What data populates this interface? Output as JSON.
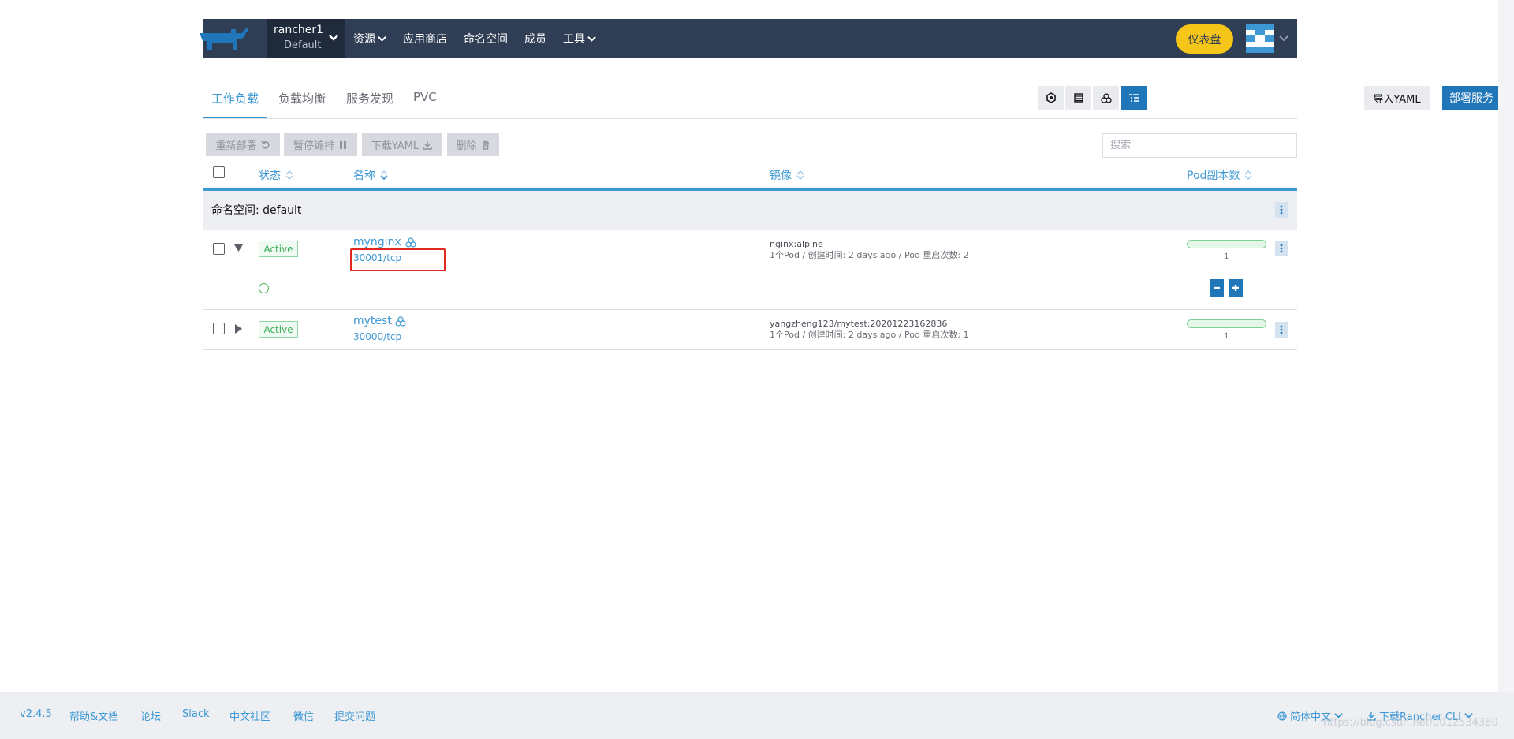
{
  "header": {
    "cluster_name": "rancher1",
    "project_name": "Default",
    "nav": [
      {
        "label": "资源",
        "dropdown": true
      },
      {
        "label": "应用商店",
        "dropdown": false
      },
      {
        "label": "命名空间",
        "dropdown": false
      },
      {
        "label": "成员",
        "dropdown": false
      },
      {
        "label": "工具",
        "dropdown": true
      }
    ],
    "dashboard_label": "仪表盘",
    "colors": {
      "bar": "#2f3e55",
      "cluster_bg": "#1f2a3a",
      "dashboard": "#f5c518",
      "logo": "#1f76b9"
    }
  },
  "tabs": {
    "items": [
      "工作负载",
      "负载均衡",
      "服务发现",
      "PVC"
    ],
    "active_index": 0,
    "view_icons": [
      "node-view-icon",
      "list-view-icon",
      "workload-view-icon",
      "group-view-icon"
    ],
    "selected_view": 3,
    "import_label": "导入YAML",
    "deploy_label": "部署服务"
  },
  "bulk_actions": {
    "redeploy": "重新部署",
    "pause": "暂停编排",
    "download": "下载YAML",
    "delete": "删除"
  },
  "search": {
    "placeholder": "搜索",
    "value": ""
  },
  "table": {
    "columns": {
      "state": "状态",
      "name": "名称",
      "image": "镜像",
      "scale": "Pod副本数"
    },
    "group": {
      "label": "命名空间: default"
    },
    "rows": [
      {
        "state": "Active",
        "name": "mynginx",
        "port": "30001/tcp",
        "image": "nginx:alpine",
        "meta": "1个Pod / 创建时间: 2 days ago / Pod 重启次数: 2",
        "scale": "1",
        "expanded": true
      },
      {
        "state": "Active",
        "name": "mytest",
        "port": "30000/tcp",
        "image": "yangzheng123/mytest:20201223162836",
        "meta": "1个Pod / 创建时间: 2 days ago / Pod 重启次数: 1",
        "scale": "1",
        "expanded": false
      }
    ]
  },
  "footer": {
    "version": "v2.4.5",
    "links": [
      "帮助&文档",
      "论坛",
      "Slack",
      "中文社区",
      "微信",
      "提交问题"
    ],
    "language": "简体中文",
    "download_cli": "下载Rancher CLI"
  },
  "watermark": "https://blog.csdn.net/u012534380"
}
